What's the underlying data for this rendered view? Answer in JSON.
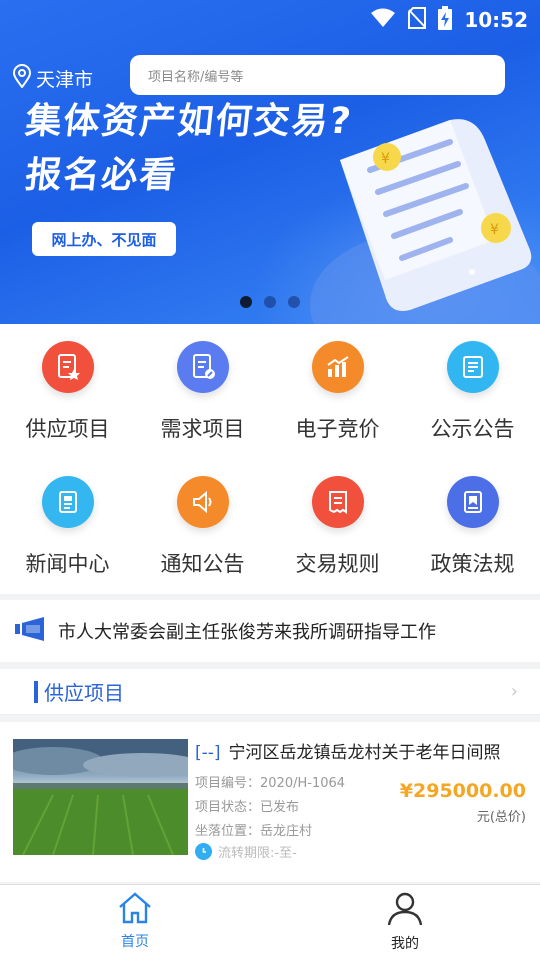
{
  "status_bar": {
    "time": "10:52",
    "icons": [
      "wifi-icon",
      "no-sim-icon",
      "battery-charging-icon"
    ]
  },
  "header": {
    "city": "天津市",
    "search_placeholder": "项目名称/编号等"
  },
  "banner": {
    "title": "集体资产如何交易?",
    "subtitle": "报名必看",
    "pill": "网上办、不见面",
    "slides": 3,
    "active_slide": 1
  },
  "menu": [
    {
      "label": "供应项目",
      "icon": "document-star-icon",
      "color": "#f0503c"
    },
    {
      "label": "需求项目",
      "icon": "document-edit-icon",
      "color": "#5b7cf0"
    },
    {
      "label": "电子竞价",
      "icon": "chart-up-icon",
      "color": "#f58a2b"
    },
    {
      "label": "公示公告",
      "icon": "notice-board-icon",
      "color": "#31b6f2"
    },
    {
      "label": "新闻中心",
      "icon": "newspaper-icon",
      "color": "#34b7f0"
    },
    {
      "label": "通知公告",
      "icon": "speaker-icon",
      "color": "#f58a2b"
    },
    {
      "label": "交易规则",
      "icon": "receipt-icon",
      "color": "#f0503c"
    },
    {
      "label": "政策法规",
      "icon": "book-icon",
      "color": "#4c6ee6"
    }
  ],
  "ticker": {
    "text": "市人大常委会副主任张俊芳来我所调研指导工作"
  },
  "section": {
    "title": "供应项目",
    "more": "›"
  },
  "card": {
    "tag": "[--]",
    "title": "宁河区岳龙镇岳龙村关于老年日间照",
    "code_label": "项目编号：",
    "code": "2020/H-1064",
    "status_label": "项目状态：",
    "status": "已发布",
    "location_label": "坐落位置：",
    "location": "岳龙庄村",
    "period": "流转期限:-至-",
    "price": "¥295000.00",
    "unit": "元(总价)"
  },
  "bottom_nav": [
    {
      "label": "首页",
      "icon": "home-icon",
      "active": true
    },
    {
      "label": "我的",
      "icon": "user-icon",
      "active": false
    }
  ]
}
